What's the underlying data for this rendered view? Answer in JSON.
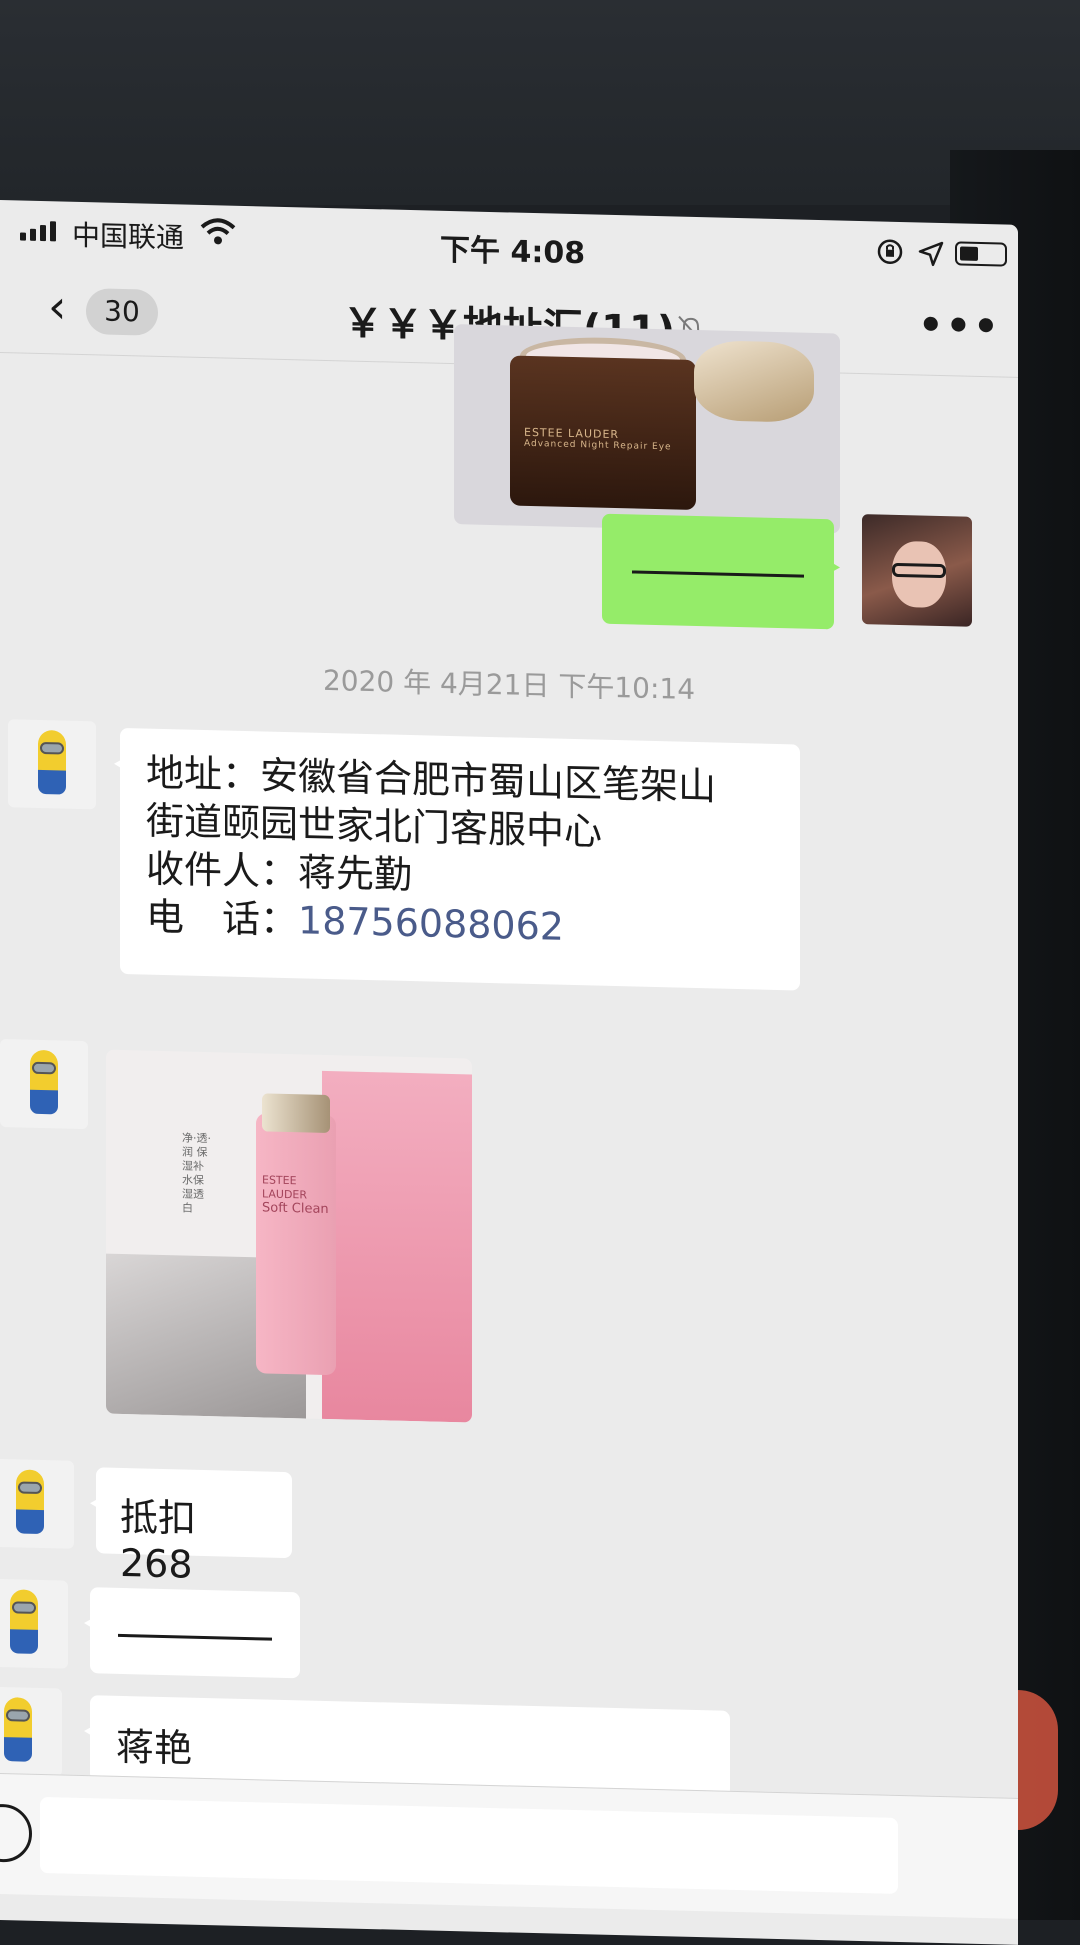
{
  "status_bar": {
    "carrier": "中国联通",
    "time": "下午 4:08"
  },
  "nav": {
    "back_count": "30",
    "title": "￥￥￥地址汇(11)"
  },
  "icons": {
    "back": "chevron-left-icon",
    "mute": "bell-muted-icon",
    "more": "ellipsis-icon",
    "wifi": "wifi-icon",
    "signal": "signal-bars-icon",
    "battery": "battery-icon",
    "location": "location-arrow-icon",
    "rotation_lock": "rotation-lock-icon"
  },
  "messages": {
    "product_image_1_brand": "ESTEE LAUDER",
    "product_image_1_text": "Advanced Night Repair Eye",
    "timestamp": "2020 年 4月21日 下午10:14",
    "address_lines": [
      "地址：安徽省合肥市蜀山区笔架山",
      "街道颐园世家北门客服中心",
      "收件人：蒋先勤",
      "电　话："
    ],
    "phone": "18756088062",
    "product_image_2_brand": "ESTEE LAUDER",
    "product_image_2_name": "Soft Clean",
    "product_image_2_side_text": "净·透·润 保湿补水保湿透白",
    "amount": "抵扣 268",
    "name": "蒋艳"
  },
  "colors": {
    "sent_bubble": "#95ec69",
    "received_bubble": "#ffffff",
    "chat_background": "#ebebeb",
    "phone_link": "#4a5b8a"
  }
}
